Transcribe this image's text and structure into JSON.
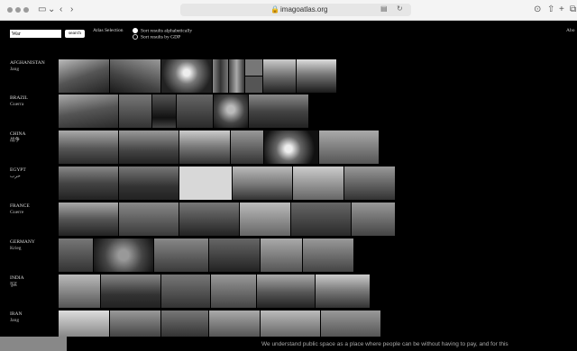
{
  "browser": {
    "url": "imagoatlas.org"
  },
  "search": {
    "value": "War",
    "button_label": "search"
  },
  "atlas_selection_label": "Atlas Selection",
  "sort_options": [
    {
      "label": "Sort results alphabetically",
      "selected": true
    },
    {
      "label": "Sort results by GDP",
      "selected": false
    }
  ],
  "about_label": "Abo",
  "countries": [
    {
      "name": "AFGHANISTAN",
      "translation": "Jang",
      "images": 9
    },
    {
      "name": "BRAZIL",
      "translation": "Guerra",
      "images": 6
    },
    {
      "name": "CHINA",
      "translation": "战争",
      "images": 7
    },
    {
      "name": "EGYPT",
      "translation": "حرب",
      "images": 6
    },
    {
      "name": "FRANCE",
      "translation": "Guerre",
      "images": 6
    },
    {
      "name": "GERMANY",
      "translation": "Krieg",
      "images": 6
    },
    {
      "name": "INDIA",
      "translation": "युद्ध",
      "images": 6
    },
    {
      "name": "IRAN",
      "translation": "Jang",
      "images": 6
    }
  ],
  "footer_text": "We understand public space as a place where people can be without having to pay, and for this"
}
